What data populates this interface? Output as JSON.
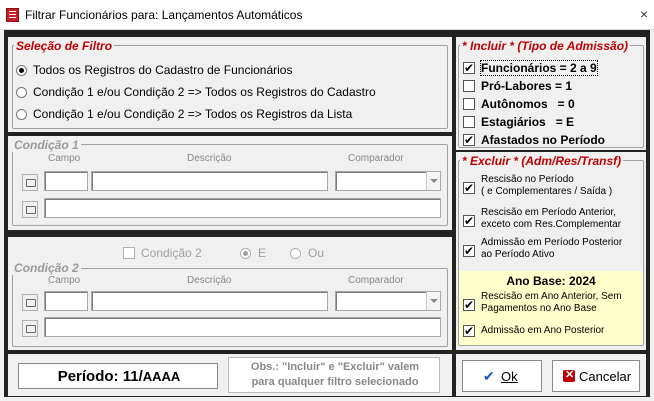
{
  "window": {
    "title": "Filtrar Funcionários para: Lançamentos Automáticos",
    "close": "×"
  },
  "selecao": {
    "legend": "Seleção de Filtro",
    "options": [
      {
        "label": "Todos os Registros do Cadastro de Funcionários",
        "selected": true
      },
      {
        "label": "Condição 1 e/ou Condição 2 => Todos os Registros do Cadastro",
        "selected": false
      },
      {
        "label": "Condição 1 e/ou Condição 2 => Todos os Registros da Lista",
        "selected": false
      }
    ]
  },
  "condicao1": {
    "legend": "Condição 1",
    "campo": "Campo",
    "descricao": "Descrição",
    "comparador": "Comparador"
  },
  "condicao2": {
    "legend": "Condição 2",
    "campo": "Campo",
    "descricao": "Descrição",
    "comparador": "Comparador",
    "toggle_label": "Condição 2",
    "op_e": "E",
    "op_ou": "Ou"
  },
  "incluir": {
    "legend": "* Incluir * (Tipo de Admissão)",
    "items": [
      {
        "label": "Funcionários = 2 a 9",
        "checked": true
      },
      {
        "label": "Pró-Labores = 1",
        "checked": false
      },
      {
        "label": "Autônomos   = 0",
        "checked": false
      },
      {
        "label": "Estagiários   = E",
        "checked": false
      },
      {
        "label": "Afastados no Período",
        "checked": true
      }
    ]
  },
  "excluir": {
    "legend": "* Excluir * (Adm/Res/Transf)",
    "items": [
      {
        "line1": "Rescisão no Período",
        "line2": "( e Complementares / Saída )",
        "checked": true
      },
      {
        "line1": "Rescisão em Período Anterior,",
        "line2": "exceto com Res.Complementar",
        "checked": true
      },
      {
        "line1": "Admissão em Período Posterior",
        "line2": "ao Período Ativo",
        "checked": true
      }
    ]
  },
  "ano_base": {
    "title": "Ano Base: 2024",
    "items": [
      {
        "line1": "Rescisão em Ano Anterior, Sem",
        "line2": "Pagamentos no Ano Base",
        "checked": true
      },
      {
        "line1": "Admissão em Ano Posterior",
        "line2": "",
        "checked": true
      }
    ]
  },
  "footer": {
    "periodo_label": "Período: 11/",
    "periodo_suffix": "AAAA",
    "obs_line1": "Obs.: \"Incluir\" e \"Excluir\" valem",
    "obs_line2": "para qualquer filtro selecionado",
    "ok": "Ok",
    "cancelar": "Cancelar"
  }
}
